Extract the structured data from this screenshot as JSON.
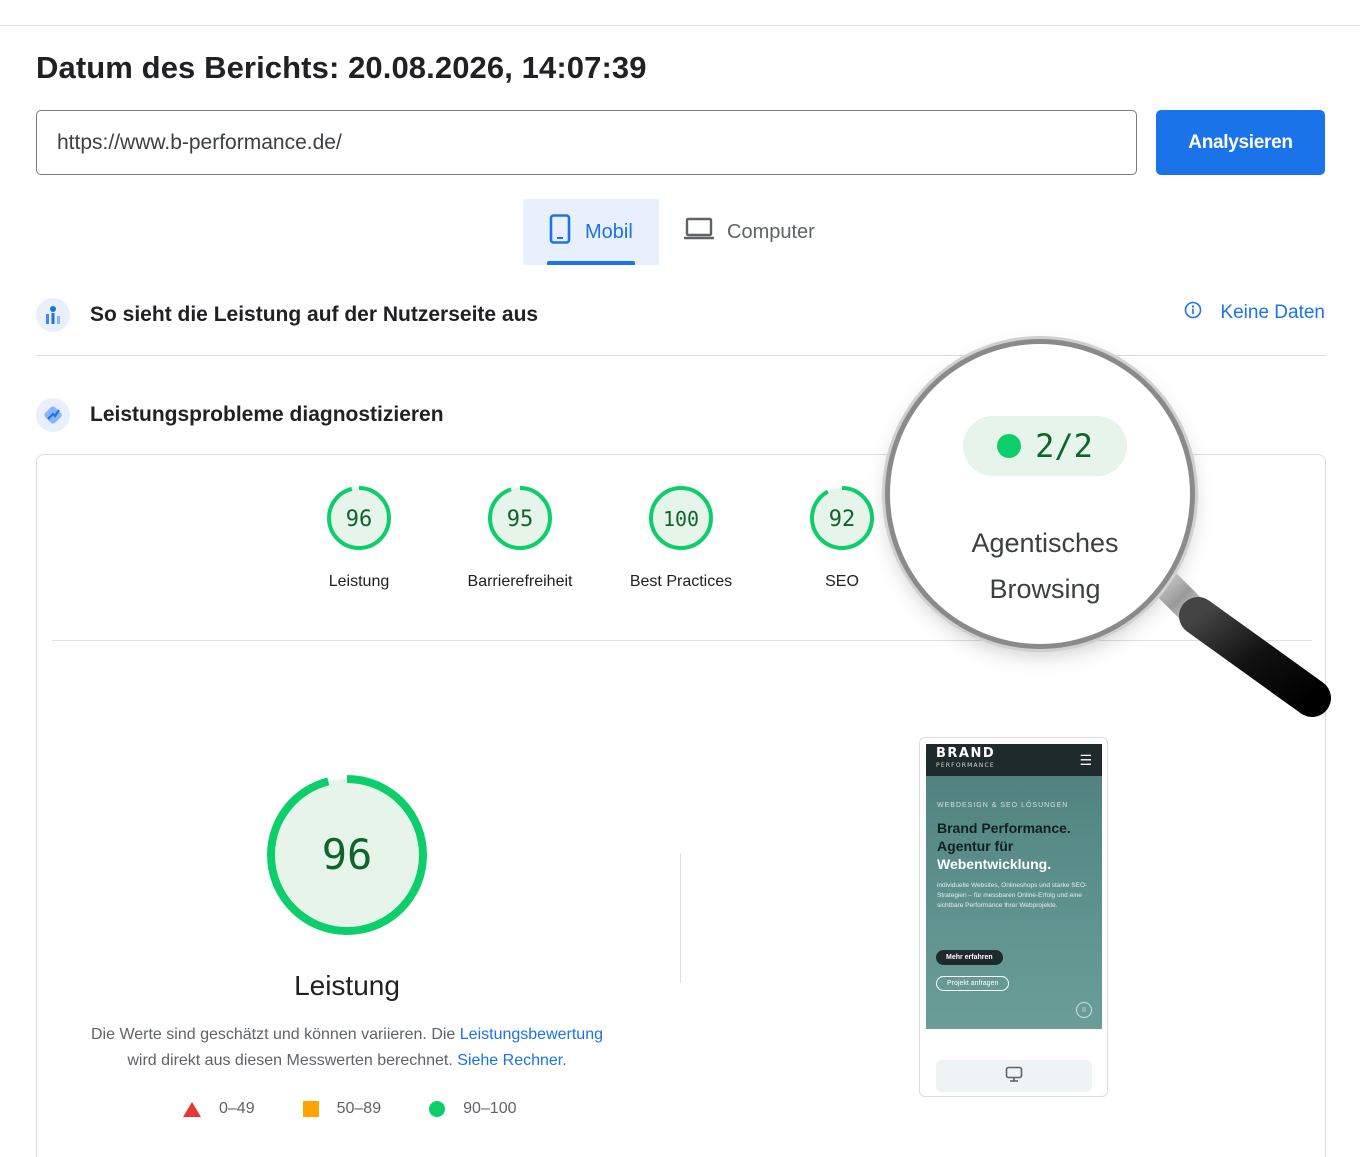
{
  "header": {
    "report_date": "Datum des Berichts: 20.08.2026, 14:07:39"
  },
  "search": {
    "url_value": "https://www.b-performance.de/",
    "analyze_label": "Analysieren"
  },
  "device_tabs": {
    "mobile_label": "Mobil",
    "desktop_label": "Computer"
  },
  "field_data": {
    "title": "So sieht die Leistung auf der Nutzerseite aus",
    "no_data_label": "Keine Daten"
  },
  "lab_data": {
    "title": "Leistungsprobleme diagnostizieren"
  },
  "scores": [
    {
      "value": "96",
      "label": "Leistung",
      "fraction": 0.96
    },
    {
      "value": "95",
      "label": "Barrierefreiheit",
      "fraction": 0.95
    },
    {
      "value": "100",
      "label": "Best Practices",
      "fraction": 1.0
    },
    {
      "value": "92",
      "label": "SEO",
      "fraction": 0.92
    }
  ],
  "magnifier": {
    "badge_value": "2/2",
    "label_line1": "Agentisches",
    "label_line2": "Browsing"
  },
  "performance": {
    "score": "96",
    "fraction": 0.96,
    "title": "Leistung",
    "desc_part1": "Die Werte sind geschätzt und können variieren. Die ",
    "desc_link1": "Leistungsbewertung",
    "desc_part2": " wird direkt aus diesen Messwerten berechnet. ",
    "desc_link2": "Siehe Rechner."
  },
  "legend": {
    "fail": "0–49",
    "average": "50–89",
    "pass": "90–100"
  },
  "preview": {
    "brand": "BRAND",
    "brand_sub": "PERFORMANCE",
    "eyebrow": "WEBDESIGN & SEO LÖSUNGEN",
    "headline_dark": "Brand Performance. Agentur für",
    "headline_light": "Webentwicklung.",
    "body": "individuelle Websites, Onlineshops und starke SEO-Strategien – für messbaren Online-Erfolg und eine sichtbare Performance Ihrer Webprojekte.",
    "btn_primary": "Mehr erfahren",
    "btn_secondary": "Projekt anfragen"
  },
  "colors": {
    "accent": "#1a73e8",
    "pass_green": "#0cce6b",
    "pass_text": "#0d652d",
    "pass_bg": "#e6f4ea",
    "fail_red": "#e8382f",
    "average_orange": "#ffa400"
  }
}
